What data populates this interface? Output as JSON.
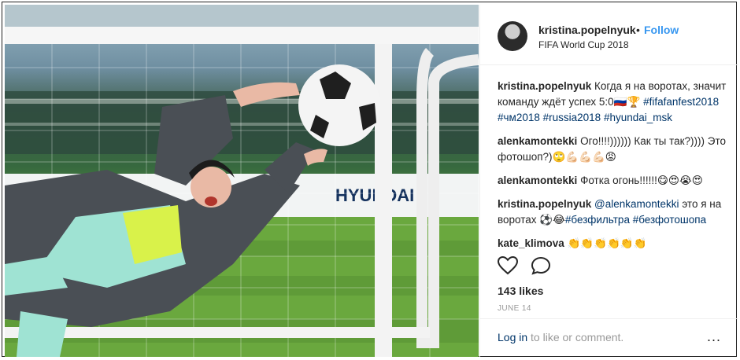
{
  "header": {
    "username": "kristina.popelnyuk",
    "separator": "•",
    "follow_label": "Follow",
    "location": "FIFA World Cup 2018"
  },
  "caption": {
    "username": "kristina.popelnyuk",
    "text": "Когда я на воротах, значит команду ждёт успех 5:0",
    "emoji_flag": "🇷🇺",
    "emoji_trophy": "🏆",
    "hashtags": [
      "#fifafanfest2018",
      "#чм2018",
      "#russia2018",
      "#hyundai_msk"
    ]
  },
  "comments": [
    {
      "username": "alenkamontekki",
      "text": "Ого!!!!)))))) Как ты так?)))) Это фотошоп?)",
      "emojis": "🙄💪🏻💪🏻💪🏻😡"
    },
    {
      "username": "alenkamontekki",
      "text": "Фотка огонь!!!!!!",
      "emojis": "😋😍😭😍"
    },
    {
      "username": "kristina.popelnyuk",
      "mention": "@alenkamontekki",
      "text": "это я на воротах",
      "emojis": "⚽😂",
      "hashtags": [
        "#безфильтра",
        "#безфотошопа"
      ]
    },
    {
      "username": "kate_klimova",
      "text": "",
      "emojis": "👏👏👏👏👏👏"
    }
  ],
  "stats": {
    "likes": "143 likes",
    "date": "JUNE 14"
  },
  "footer": {
    "login_link": "Log in",
    "login_rest": " to like or comment.",
    "more": "..."
  },
  "photo": {
    "banner_text": "HYUNDAI"
  }
}
